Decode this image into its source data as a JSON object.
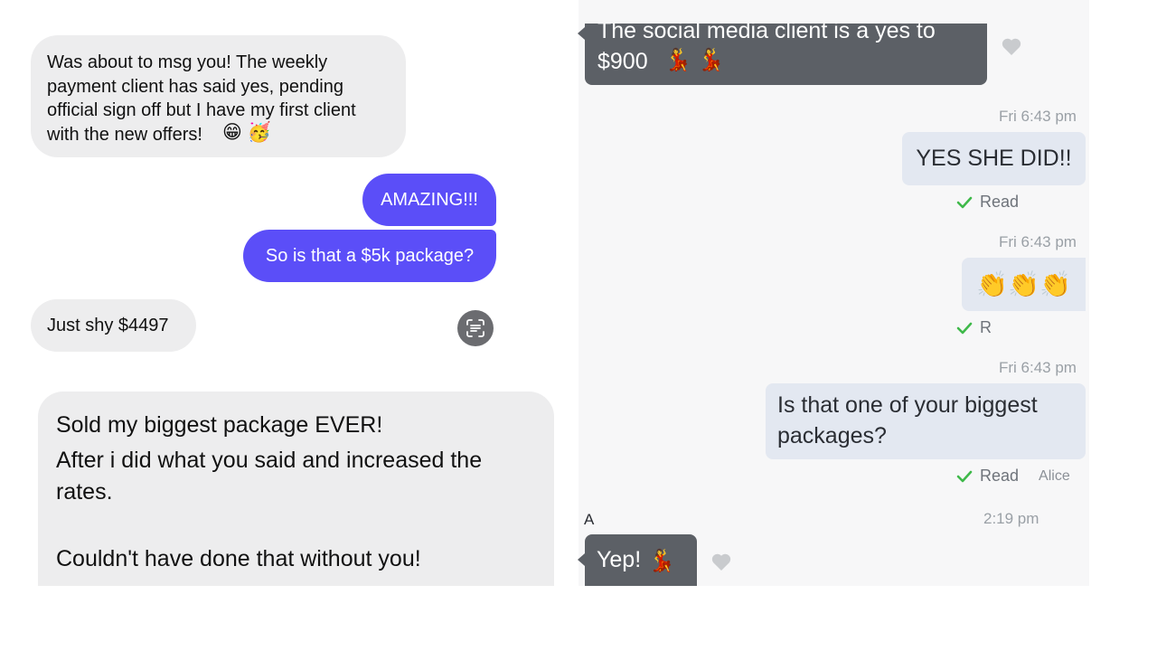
{
  "left_chat": {
    "msg1": "Was about to msg you! The weekly\npayment client has said yes, pending\nofficial sign off but I have my first client\nwith the new offers!",
    "msg1_emojis": [
      "😁",
      "🥳"
    ],
    "msg2": "AMAZING!!!",
    "msg3": "So is that a $5k package?",
    "msg4": "Just shy $4497",
    "msg5_line1": "Sold my biggest package EVER!",
    "msg5_line2": "After i did what you said and increased the\nrates.",
    "msg5_line3": "Couldn't have done that without you!"
  },
  "right_chat": {
    "top_msg": "The social media client is a yes to\n$900",
    "top_msg_emojis": [
      "💃",
      "💃"
    ],
    "timestamp1": "Fri 6:43 pm",
    "reply1": "YES SHE DID!!",
    "read1": "Read",
    "timestamp2": "Fri 6:43 pm",
    "reply2_emojis": [
      "👏",
      "👏",
      "👏"
    ],
    "read2": "R",
    "timestamp3": "Fri 6:43 pm",
    "reply3": "Is that one of your biggest\npackages?",
    "read3": "Read",
    "read3_suffix": "Alice",
    "sender_partial": "A",
    "timestamp4": "2:19 pm",
    "bottom_msg": "Yep!",
    "bottom_msg_emoji": "💃"
  },
  "colors": {
    "purple_bubble": "#5b4ef8",
    "grey_bubble": "#ededee",
    "dark_bubble": "#5c6066",
    "light_blue_bubble": "#e3e8f1",
    "read_check": "#3fb94a"
  },
  "icons": [
    "live-text-icon",
    "heart-icon",
    "checkmark-icon"
  ]
}
